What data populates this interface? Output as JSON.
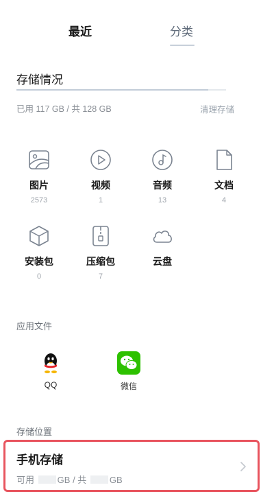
{
  "tabs": {
    "recent": "最近",
    "category": "分类"
  },
  "storage": {
    "title": "存储情况",
    "used_text": "已用 117 GB / 共 128 GB",
    "clean_label": "清理存储",
    "used_fraction": 0.914
  },
  "categories": [
    {
      "label": "图片",
      "count": "2573",
      "icon": "image-icon"
    },
    {
      "label": "视频",
      "count": "1",
      "icon": "video-icon"
    },
    {
      "label": "音频",
      "count": "13",
      "icon": "audio-icon"
    },
    {
      "label": "文档",
      "count": "4",
      "icon": "document-icon"
    },
    {
      "label": "安装包",
      "count": "0",
      "icon": "package-icon"
    },
    {
      "label": "压缩包",
      "count": "7",
      "icon": "archive-icon"
    },
    {
      "label": "云盘",
      "count": "",
      "icon": "cloud-icon"
    }
  ],
  "app_files": {
    "title": "应用文件",
    "items": [
      {
        "label": "QQ",
        "icon": "qq-icon"
      },
      {
        "label": "微信",
        "icon": "wechat-icon"
      }
    ]
  },
  "storage_location": {
    "title": "存储位置",
    "phone": {
      "title": "手机存储",
      "available_prefix": "可用",
      "gb_unit": "GB",
      "separator": "/ 共",
      "total_unit": "GB"
    }
  },
  "colors": {
    "highlight_border": "#e8545e",
    "icon_stroke": "#7a8390",
    "wechat_green": "#2dc100"
  }
}
